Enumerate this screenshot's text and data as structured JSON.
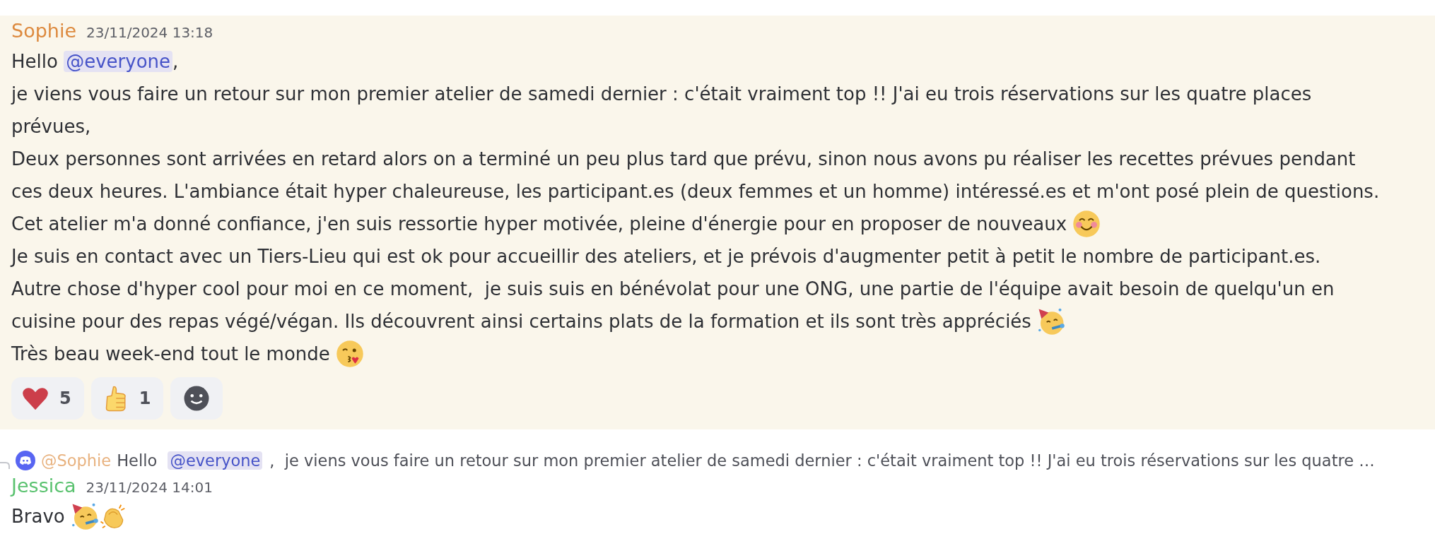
{
  "messages": [
    {
      "author": "Sophie",
      "color": "#dd8a3f",
      "timestamp": "23/11/2024 13:18",
      "highlighted": true,
      "lines": [
        [
          {
            "kind": "text",
            "text": "Hello "
          },
          {
            "kind": "mention",
            "text": "@everyone"
          },
          {
            "kind": "text",
            "text": ","
          }
        ],
        [
          {
            "kind": "text",
            "text": "je viens vous faire un retour sur mon premier atelier de samedi dernier : c'était vraiment top !! J'ai eu trois réservations sur les quatre places"
          }
        ],
        [
          {
            "kind": "text",
            "text": "prévues,"
          }
        ],
        [
          {
            "kind": "text",
            "text": "Deux personnes sont arrivées en retard alors on a terminé un peu plus tard que prévu, sinon nous avons pu réaliser les recettes prévues pendant"
          }
        ],
        [
          {
            "kind": "text",
            "text": "ces deux heures. L'ambiance était hyper chaleureuse, les participant.es (deux femmes et un homme) intéressé.es et m'ont posé plein de questions."
          }
        ],
        [
          {
            "kind": "text",
            "text": "Cet atelier m'a donné confiance, j'en suis ressortie hyper motivée, pleine d'énergie pour en proposer de nouveaux "
          },
          {
            "kind": "blush"
          }
        ],
        [
          {
            "kind": "text",
            "text": "Je suis en contact avec un Tiers-Lieu qui est ok pour accueillir des ateliers, et je prévois d'augmenter petit à petit le nombre de participant.es."
          }
        ],
        [
          {
            "kind": "text",
            "text": "Autre chose d'hyper cool pour moi en ce moment,  je suis suis en bénévolat pour une ONG, une partie de l'équipe avait besoin de quelqu'un en"
          }
        ],
        [
          {
            "kind": "text",
            "text": "cuisine pour des repas végé/végan. Ils découvrent ainsi certains plats de la formation et ils sont très appréciés "
          },
          {
            "kind": "party"
          }
        ],
        [
          {
            "kind": "text",
            "text": "Très beau week-end tout le monde "
          },
          {
            "kind": "kiss"
          }
        ]
      ],
      "reactions": [
        {
          "kind": "heart",
          "count": "5"
        },
        {
          "kind": "thumbs",
          "count": "1"
        },
        {
          "kind": "add"
        }
      ]
    },
    {
      "reply": {
        "author": "@Sophie",
        "color": "#e8b27f",
        "segments": [
          {
            "kind": "text",
            "text": "Hello "
          },
          {
            "kind": "mention",
            "text": "@everyone"
          },
          {
            "kind": "text",
            "text": ",  je viens vous faire un retour sur mon premier atelier de samedi dernier : c'était vraiment top !! J'ai eu trois réservations sur les quatre …"
          }
        ]
      },
      "author": "Jessica",
      "color": "#5ac26f",
      "timestamp": "23/11/2024 14:01",
      "highlighted": false,
      "lines": [
        [
          {
            "kind": "text",
            "text": "Bravo "
          },
          {
            "kind": "party"
          },
          {
            "kind": "clap"
          }
        ]
      ]
    }
  ]
}
